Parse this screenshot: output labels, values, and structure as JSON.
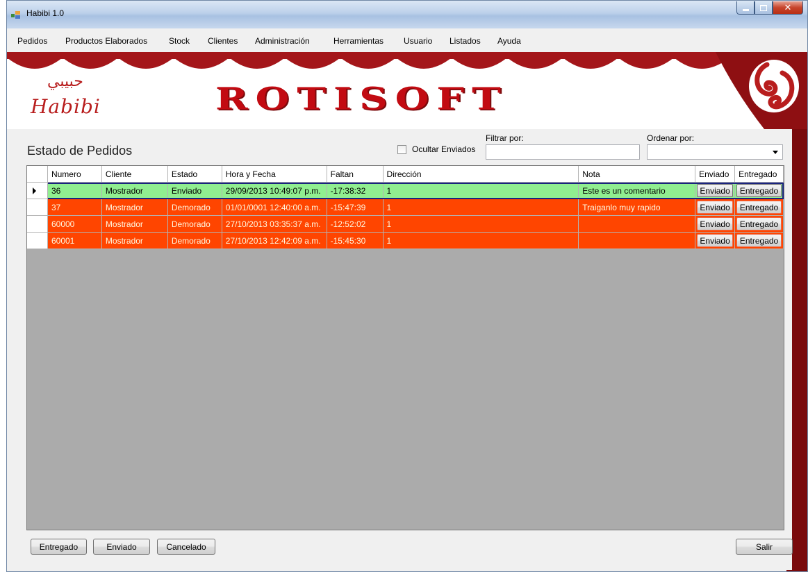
{
  "window": {
    "title": "Habibi 1.0",
    "icon": "app-icon",
    "caption_buttons": [
      "minimize-icon",
      "maximize-icon",
      "close-icon"
    ]
  },
  "menu": [
    "Pedidos",
    "Productos Elaborados",
    "Stock",
    "Clientes",
    "Administración",
    "Herramientas",
    "Usuario",
    "Listados",
    "Ayuda"
  ],
  "banner": {
    "logo_arabic": "حبيبي",
    "logo_latin": "Habibi",
    "brand": "ROTISOFT",
    "colors": {
      "brand_red": "#c20b12",
      "curtain": "#a4161a"
    }
  },
  "section": {
    "title": "Estado de Pedidos",
    "hide_sent_label": "Ocultar Enviados",
    "hide_sent_checked": false,
    "filter_label": "Filtrar por:",
    "filter_value": "",
    "sort_label": "Ordenar por:",
    "sort_value": ""
  },
  "table": {
    "columns": [
      "Numero",
      "Cliente",
      "Estado",
      "Hora y Fecha",
      "Faltan",
      "Dirección",
      "Nota",
      "Enviado",
      "Entregado"
    ],
    "rows": [
      {
        "numero": "36",
        "cliente": "Mostrador",
        "estado": "Enviado",
        "hora_fecha": "29/09/2013 10:49:07 p.m.",
        "faltan": "-17:38:32",
        "direccion": "1",
        "nota": "Este es un comentario",
        "btn_enviado": "Enviado",
        "btn_entregado": "Entregado",
        "status": "green",
        "selected": true
      },
      {
        "numero": "37",
        "cliente": "Mostrador",
        "estado": "Demorado",
        "hora_fecha": "01/01/0001 12:40:00 a.m.",
        "faltan": "-15:47:39",
        "direccion": "1",
        "nota": "Traiganlo muy rapido",
        "btn_enviado": "Enviado",
        "btn_entregado": "Entregado",
        "status": "red",
        "selected": false
      },
      {
        "numero": "60000",
        "cliente": "Mostrador",
        "estado": "Demorado",
        "hora_fecha": "27/10/2013 03:35:37 a.m.",
        "faltan": "-12:52:02",
        "direccion": "1",
        "nota": "",
        "btn_enviado": "Enviado",
        "btn_entregado": "Entregado",
        "status": "red",
        "selected": false
      },
      {
        "numero": "60001",
        "cliente": "Mostrador",
        "estado": "Demorado",
        "hora_fecha": "27/10/2013 12:42:09 a.m.",
        "faltan": "-15:45:30",
        "direccion": "1",
        "nota": "",
        "btn_enviado": "Enviado",
        "btn_entregado": "Entregado",
        "status": "red",
        "selected": false
      }
    ],
    "status_colors": {
      "green": "#90ee90",
      "red": "#ff4500"
    }
  },
  "footer": {
    "entregado": "Entregado",
    "enviado": "Enviado",
    "cancelado": "Cancelado",
    "salir": "Salir"
  }
}
